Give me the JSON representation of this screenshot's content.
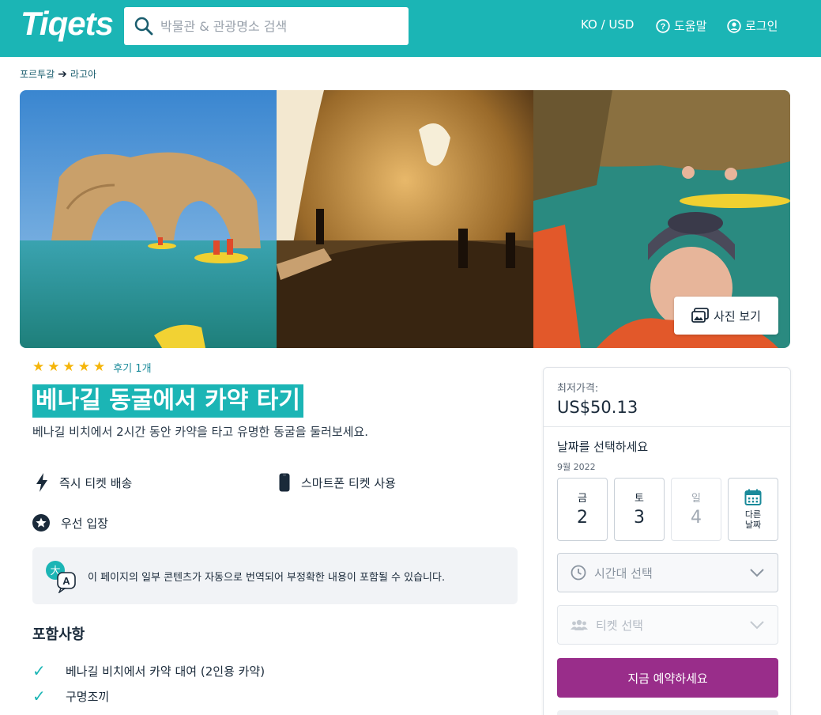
{
  "header": {
    "logo": "Tiqets",
    "search_placeholder": "박물관 & 관광명소 검색",
    "locale": "KO / USD",
    "help": "도움말",
    "login": "로그인"
  },
  "breadcrumb": {
    "country": "포르투갈",
    "city": "라고아"
  },
  "gallery": {
    "view_photos": "사진 보기"
  },
  "product": {
    "rating_stars": 5,
    "reviews": "후기 1개",
    "title": "베나길 동굴에서 카약 타기",
    "subtitle": "베나길 비치에서 2시간 동안 카약을 타고 유명한 동굴을 둘러보세요.",
    "features": {
      "instant": "즉시 티켓 배송",
      "smartphone": "스마트폰 티켓 사용",
      "priority": "우선 입장"
    },
    "notice": "이 페이지의 일부 콘텐츠가 자동으로 번역되어 부정확한 내용이 포함될 수 있습니다.",
    "included_title": "포함사항",
    "included": [
      "베나길 비치에서 카약 대여 (2인용 카약)",
      "구명조끼"
    ]
  },
  "booking": {
    "from_label": "최저가격:",
    "price": "US$50.13",
    "date_label": "날짜를 선택하세요",
    "month": "9월 2022",
    "days": [
      {
        "dow": "금",
        "num": "2"
      },
      {
        "dow": "토",
        "num": "3"
      },
      {
        "dow": "일",
        "num": "4"
      }
    ],
    "other_dates_1": "다른",
    "other_dates_2": "날짜",
    "timeslot": "시간대 선택",
    "tickets": "티켓 선택",
    "book_now": "지금 예약하세요"
  },
  "colors": {
    "brand": "#1bb5b5",
    "cta": "#992d8a",
    "star": "#f5b50a"
  }
}
